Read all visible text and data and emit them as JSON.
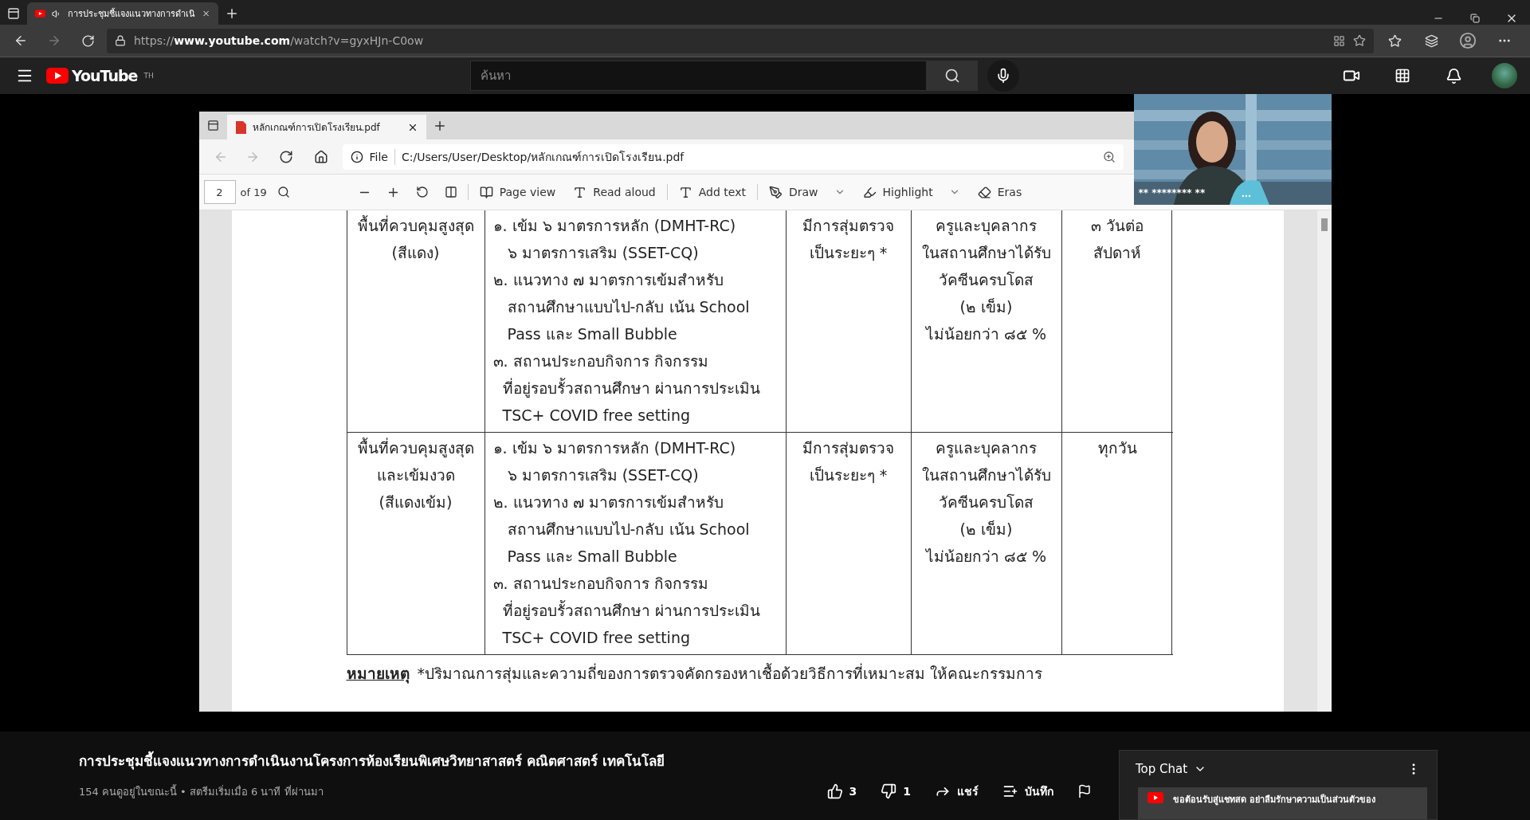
{
  "browser": {
    "tab_title": "การประชุมชี้แจงแนวทางการดำเนิ",
    "url": "https://**www.youtube.com**/watch?v=gyxHJn-C0ow"
  },
  "youtube_header": {
    "logo": "YouTube",
    "region": "TH",
    "search": {
      "placeholder": "ค้นหา"
    }
  },
  "pdf_viewer": {
    "tab_title": "หลักเกณฑ์การเปิดโรงเรียน.pdf",
    "file_label": "File",
    "path": "C:/Users/User/Desktop/หลักเกณฑ์การเปิดโรงเรียน.pdf",
    "page": "2",
    "page_count": "of 19",
    "tools": [
      {
        "kind": "view",
        "label": "Page view"
      },
      {
        "kind": "read",
        "label": "Read aloud"
      },
      {
        "kind": "text",
        "label": "Add text"
      },
      {
        "kind": "draw",
        "label": "Draw"
      },
      {
        "kind": "highlight",
        "label": "Highlight"
      },
      {
        "kind": "erase",
        "label": "Eras"
      }
    ],
    "table_rows": [
      {
        "cells": [
          {
            "lines": [
              "พื้นที่ควบคุมสูงสุด",
              "(สีแดง)"
            ]
          },
          {
            "lines": [
              "๑. เข้ม ๖ มาตรการหลัก (DMHT-RC)",
              "   ๖ มาตรการเสริม (SSET-CQ)",
              "๒. แนวทาง ๗ มาตรการเข้มสำหรับ",
              "   สถานศึกษาแบบไป-กลับ เน้น School",
              "   Pass และ Small Bubble",
              "๓. สถานประกอบกิจการ กิจกรรม",
              "  ที่อยู่รอบรั้วสถานศึกษา ผ่านการประเมิน",
              "  TSC+ COVID free setting"
            ]
          },
          {
            "lines": [
              "มีการสุ่มตรวจ",
              "เป็นระยะๆ *"
            ]
          },
          {
            "lines": [
              "ครูและบุคลากร",
              "ในสถานศึกษาได้รับ",
              "วัคซีนครบโดส",
              "(๒ เข็ม)",
              "ไม่น้อยกว่า ๘๕ %"
            ]
          },
          {
            "lines": [
              "๓ วันต่อ",
              "สัปดาห์"
            ]
          }
        ]
      },
      {
        "cells": [
          {
            "lines": [
              "พื้นที่ควบคุมสูงสุด",
              "และเข้มงวด",
              "(สีแดงเข้ม)"
            ]
          },
          {
            "lines": [
              "๑. เข้ม ๖ มาตรการหลัก (DMHT-RC)",
              "   ๖ มาตรการเสริม (SSET-CQ)",
              "๒. แนวทาง ๗ มาตรการเข้มสำหรับ",
              "   สถานศึกษาแบบไป-กลับ เน้น School",
              "   Pass และ Small Bubble",
              "๓. สถานประกอบกิจการ กิจกรรม",
              "  ที่อยู่รอบรั้วสถานศึกษา ผ่านการประเมิน",
              "  TSC+ COVID free setting"
            ]
          },
          {
            "lines": [
              "มีการสุ่มตรวจ",
              "เป็นระยะๆ *"
            ]
          },
          {
            "lines": [
              "ครูและบุคลากร",
              "ในสถานศึกษาได้รับ",
              "วัคซีนครบโดส",
              "(๒ เข็ม)",
              "ไม่น้อยกว่า ๘๕ %"
            ]
          },
          {
            "lines": [
              "ทุกวัน"
            ]
          }
        ]
      }
    ],
    "note": {
      "label": "หมายเหตุ",
      "text": "*ปริมาณการสุ่มและความถี่ของการตรวจคัดกรองหาเชื้อด้วยวิธีการที่เหมาะสม ให้คณะกรรมการ"
    }
  },
  "webcam": {
    "kind": "picture",
    "name_label": "** ******** **"
  },
  "video_info": {
    "title": "การประชุมชี้แจงแนวทางการดำเนินงานโครงการห้องเรียนพิเศษวิทยาสาสตร์ คณิตศาสตร์ เทคโนโลยี",
    "meta": "154 คนดูอยู่ในขณะนี้ • สตรีมเริ่มเมื่อ 6 นาที ที่ผ่านมา",
    "likes": "3",
    "dislikes": "1",
    "share": "แชร์",
    "save": "บันทึก"
  },
  "chat": {
    "title": "Top Chat",
    "message": "ขอต้อนรับสู่แชทสด อย่าลืมรักษาความเป็นส่วนตัวของ"
  }
}
